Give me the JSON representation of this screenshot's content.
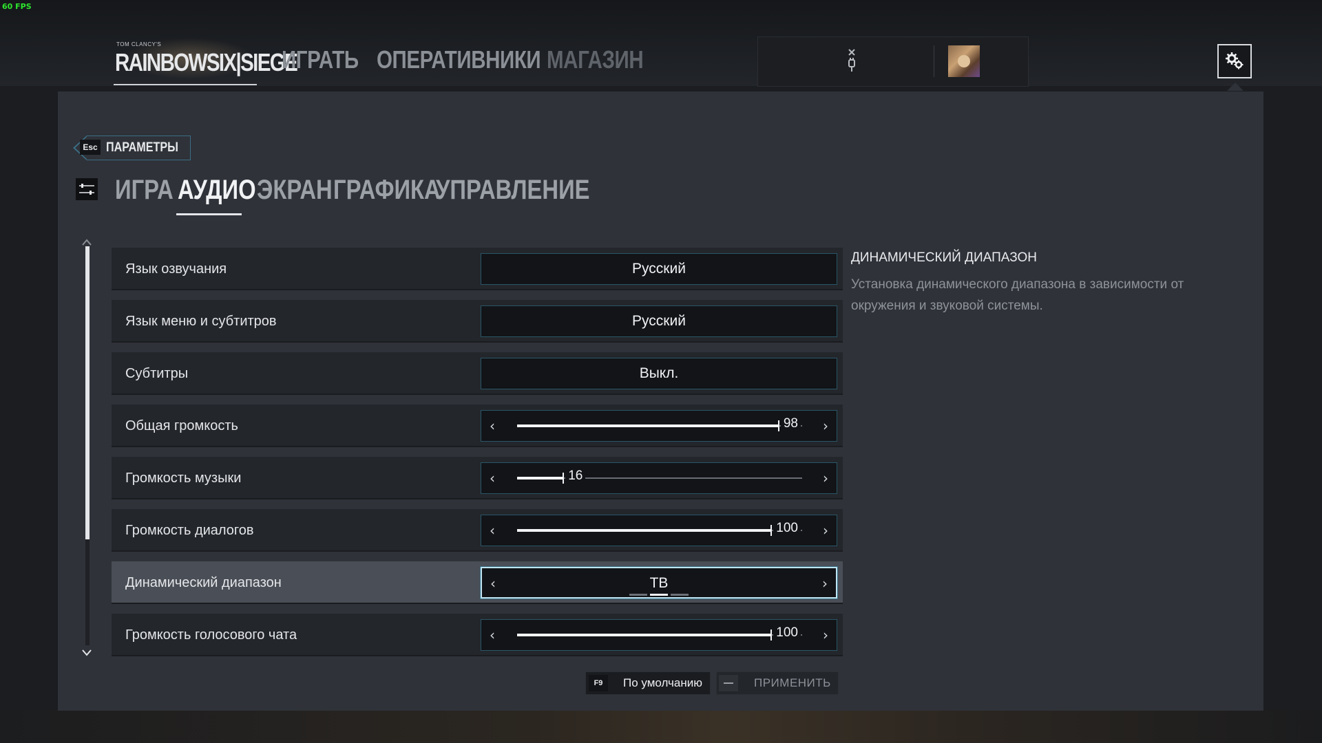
{
  "overlay": {
    "fps": "60 FPS"
  },
  "nav": {
    "logo_small": "TOM CLANCY'S",
    "logo_main": "RAINBOWSIX|SIEGE",
    "items": [
      {
        "label": "ИГРАТЬ"
      },
      {
        "label": "ОПЕРАТИВНИКИ"
      },
      {
        "label": "МАГАЗИН"
      }
    ]
  },
  "header": {
    "back_key": "Esc",
    "back_label": "ПАРАМЕТРЫ"
  },
  "tabs": [
    {
      "label": "ИГРА",
      "active": false
    },
    {
      "label": "АУДИО",
      "active": true
    },
    {
      "label": "ЭКРАН",
      "active": false
    },
    {
      "label": "ГРАФИКА",
      "active": false
    },
    {
      "label": "УПРАВЛЕНИЕ",
      "active": false
    }
  ],
  "settings": [
    {
      "label": "Язык озвучания",
      "type": "select",
      "value": "Русский"
    },
    {
      "label": "Язык меню и субтитров",
      "type": "select",
      "value": "Русский"
    },
    {
      "label": "Субтитры",
      "type": "select",
      "value": "Выкл."
    },
    {
      "label": "Общая громкость",
      "type": "slider",
      "value": "98",
      "level": 98
    },
    {
      "label": "Громкость музыки",
      "type": "slider",
      "value": "16",
      "level": 16
    },
    {
      "label": "Громкость диалогов",
      "type": "slider",
      "value": "100",
      "level": 100
    },
    {
      "label": "Динамический диапазон",
      "type": "selector",
      "value": "ТВ",
      "selected": true
    },
    {
      "label": "Громкость голосового чата",
      "type": "slider",
      "value": "100",
      "level": 100
    }
  ],
  "description": {
    "title": "ДИНАМИЧЕСКИЙ ДИАПАЗОН",
    "text": "Установка динамического диапазона в зависимости от окружения и звуковой системы."
  },
  "footer": {
    "default_key": "F9",
    "default_label": "По умолчанию",
    "apply_label": "ПРИМЕНИТЬ"
  },
  "colors": {
    "accent": "#3a6f86",
    "panel": "#2f3239",
    "selected_row": "#4a4e56"
  },
  "icons": [
    "settings-gear-icon",
    "plug-icon",
    "filter-sliders-icon",
    "chevron-left-icon",
    "chevron-right-icon",
    "scroll-up-icon",
    "scroll-down-icon"
  ]
}
